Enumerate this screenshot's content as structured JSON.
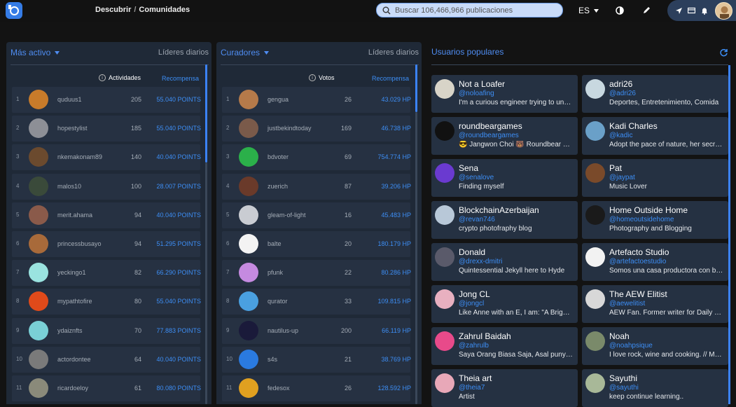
{
  "header": {
    "breadcrumb": [
      "Descubrir",
      "Comunidades"
    ],
    "search_placeholder": "Buscar 106,466,966 publicaciones",
    "lang": "ES",
    "colors": {
      "accent": "#357ce6",
      "link": "#3d8ef5"
    }
  },
  "most_active": {
    "title": "Más activo",
    "period": "Líderes diarios",
    "col_count": "Actividades",
    "col_reward": "Recompensa",
    "rows": [
      {
        "rank": "1",
        "name": "quduus1",
        "count": "205",
        "value": "55.040 POINTS",
        "color": "#c87b2a"
      },
      {
        "rank": "2",
        "name": "hopestylist",
        "count": "185",
        "value": "55.040 POINTS",
        "color": "#8d8f96"
      },
      {
        "rank": "3",
        "name": "nkemakonam89",
        "count": "140",
        "value": "40.040 POINTS",
        "color": "#6b4a2e"
      },
      {
        "rank": "4",
        "name": "malos10",
        "count": "100",
        "value": "28.007 POINTS",
        "color": "#3a4a3a"
      },
      {
        "rank": "5",
        "name": "merit.ahama",
        "count": "94",
        "value": "40.040 POINTS",
        "color": "#8a5a4a"
      },
      {
        "rank": "6",
        "name": "princessbusayo",
        "count": "94",
        "value": "51.295 POINTS",
        "color": "#a86a3a"
      },
      {
        "rank": "7",
        "name": "yeckingo1",
        "count": "82",
        "value": "66.290 POINTS",
        "color": "#9ae3e0"
      },
      {
        "rank": "8",
        "name": "mypathtofire",
        "count": "80",
        "value": "55.040 POINTS",
        "color": "#e04a1a"
      },
      {
        "rank": "9",
        "name": "ydaiznfts",
        "count": "70",
        "value": "77.883 POINTS",
        "color": "#7ad0d6"
      },
      {
        "rank": "10",
        "name": "actordontee",
        "count": "64",
        "value": "40.040 POINTS",
        "color": "#7a7a7a"
      },
      {
        "rank": "11",
        "name": "ricardoeloy",
        "count": "61",
        "value": "80.080 POINTS",
        "color": "#8a8a7a"
      }
    ]
  },
  "curators": {
    "title": "Curadores",
    "period": "Líderes diarios",
    "col_count": "Votos",
    "col_reward": "Recompensa",
    "rows": [
      {
        "rank": "1",
        "name": "gengua",
        "count": "26",
        "value": "43.029 HP",
        "color": "#b57a4a"
      },
      {
        "rank": "2",
        "name": "justbekindtoday",
        "count": "169",
        "value": "46.738 HP",
        "color": "#7a5a4a"
      },
      {
        "rank": "3",
        "name": "bdvoter",
        "count": "69",
        "value": "754.774 HP",
        "color": "#2bb04a"
      },
      {
        "rank": "4",
        "name": "zuerich",
        "count": "87",
        "value": "39.206 HP",
        "color": "#6a3a2a"
      },
      {
        "rank": "5",
        "name": "gleam-of-light",
        "count": "16",
        "value": "45.483 HP",
        "color": "#c9ccd2"
      },
      {
        "rank": "6",
        "name": "balte",
        "count": "20",
        "value": "180.179 HP",
        "color": "#f3f3f3"
      },
      {
        "rank": "7",
        "name": "pfunk",
        "count": "22",
        "value": "80.286 HP",
        "color": "#c58ae0"
      },
      {
        "rank": "8",
        "name": "qurator",
        "count": "33",
        "value": "109.815 HP",
        "color": "#4aa0e0"
      },
      {
        "rank": "9",
        "name": "nautilus-up",
        "count": "200",
        "value": "66.119 HP",
        "color": "#1a1a3a"
      },
      {
        "rank": "10",
        "name": "s4s",
        "count": "21",
        "value": "38.769 HP",
        "color": "#2a7ae0"
      },
      {
        "rank": "11",
        "name": "fedesox",
        "count": "26",
        "value": "128.592 HP",
        "color": "#e0a020"
      }
    ]
  },
  "popular": {
    "title": "Usuarios populares",
    "users": [
      {
        "name": "Not a Loafer",
        "handle": "@noloafing",
        "desc": "I'm a curious engineer trying to understand",
        "color": "#d8d4c8"
      },
      {
        "name": "adri26",
        "handle": "@adri26",
        "desc": "Deportes, Entretenimiento, Comida",
        "color": "#c8d8e0"
      },
      {
        "name": "roundbeargames",
        "handle": "@roundbeargames",
        "desc": "😎 Jangwon Choi 🐻 Roundbear Games",
        "color": "#111111"
      },
      {
        "name": "Kadi Charles",
        "handle": "@kadic",
        "desc": "Adopt the pace of nature, her secret is patience",
        "color": "#6aa0c8"
      },
      {
        "name": "Sena",
        "handle": "@senalove",
        "desc": "Finding myself",
        "color": "#6a3ad0"
      },
      {
        "name": "Pat",
        "handle": "@jaypat",
        "desc": "Music Lover",
        "color": "#7a4a2a"
      },
      {
        "name": "BlockchainAzerbaijan",
        "handle": "@revan746",
        "desc": "crypto photofraphy blog",
        "color": "#b8c8d8"
      },
      {
        "name": "Home Outside Home",
        "handle": "@homeoutsidehome",
        "desc": "Photography and Blogging",
        "color": "#1a1a1a"
      },
      {
        "name": "Donald",
        "handle": "@drexx-dmitri",
        "desc": "Quintessential Jekyll here to Hyde",
        "color": "#5a5a6a"
      },
      {
        "name": "Artefacto Studio",
        "handle": "@artefactoestudio",
        "desc": "Somos una casa productora con base en Lima",
        "color": "#f2f2f2"
      },
      {
        "name": "Jong CL",
        "handle": "@jongcl",
        "desc": "Like Anne with an E, I am: \"A Bright Spark\"",
        "color": "#e8b0c0"
      },
      {
        "name": "The AEW Elitist",
        "handle": "@aewelitist",
        "desc": "AEW Fan. Former writer for Daily DDT",
        "color": "#d8d8d8"
      },
      {
        "name": "Zahrul Baidah",
        "handle": "@zahrulb",
        "desc": "Saya Orang Biasa Saja, Asal punya usaha",
        "color": "#e84a8a"
      },
      {
        "name": "Noah",
        "handle": "@noahpsique",
        "desc": "I love rock, wine and cooking. // Me gusta",
        "color": "#7a8a6a"
      },
      {
        "name": "Theia art",
        "handle": "@theia7",
        "desc": "Artist",
        "color": "#e8a8b8"
      },
      {
        "name": "Sayuthi",
        "handle": "@sayuthi",
        "desc": "keep continue learning..",
        "color": "#a8b898"
      }
    ]
  }
}
